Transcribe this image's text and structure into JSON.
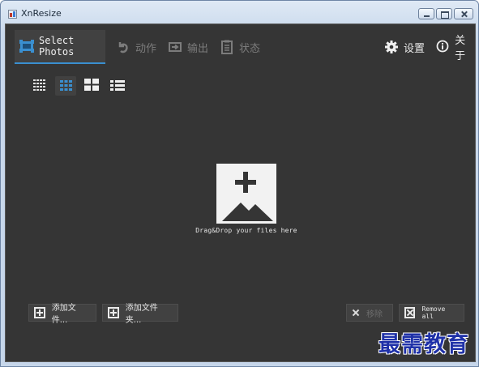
{
  "window": {
    "title": "XnResize"
  },
  "nav": {
    "tabs": [
      {
        "label": "Select Photos",
        "icon": "photo-select-icon",
        "active": true
      },
      {
        "label": "动作",
        "icon": "action-icon",
        "active": false
      },
      {
        "label": "输出",
        "icon": "output-icon",
        "active": false
      },
      {
        "label": "状态",
        "icon": "status-clipboard-icon",
        "active": false
      }
    ],
    "settings_label": "设置",
    "about_label": "关于"
  },
  "views": [
    {
      "icon": "small-grid-icon",
      "active": false
    },
    {
      "icon": "medium-grid-icon",
      "active": true
    },
    {
      "icon": "large-grid-icon",
      "active": false
    },
    {
      "icon": "list-view-icon",
      "active": false
    }
  ],
  "drop": {
    "text": "Drag&Drop your files here",
    "icon": "add-image-icon"
  },
  "buttons": {
    "add_files": "添加文件...",
    "add_folder": "添加文件夹...",
    "remove": "移除",
    "remove_all": "Remove all"
  },
  "watermark": "最需教育",
  "colors": {
    "accent": "#3a8fd0",
    "background": "#353535",
    "active_tab": "#414141",
    "watermark": "#1f31a8"
  }
}
